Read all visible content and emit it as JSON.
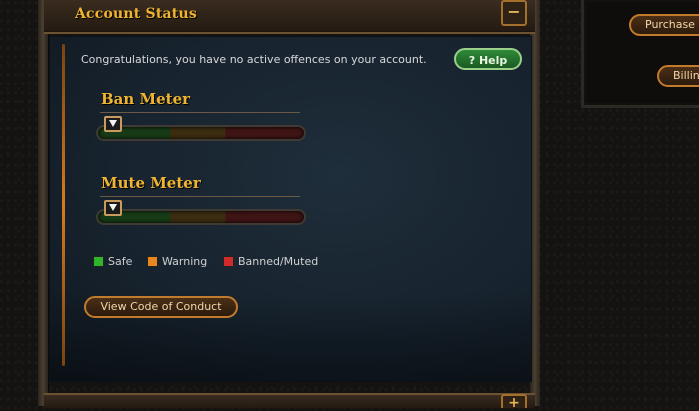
{
  "section": {
    "title": "Account Status",
    "collapse_icon": "−",
    "expand_icon": "+"
  },
  "status": {
    "message": "Congratulations, you have no active offences on your account."
  },
  "help": {
    "icon": "?",
    "label": "Help"
  },
  "meters": [
    {
      "title": "Ban Meter",
      "level": 0.0
    },
    {
      "title": "Mute Meter",
      "level": 0.0
    }
  ],
  "legend": [
    {
      "label": "Safe",
      "color": "#2fb52a"
    },
    {
      "label": "Warning",
      "color": "#e9861f"
    },
    {
      "label": "Banned/Muted",
      "color": "#d12a2a"
    }
  ],
  "actions": {
    "view_code_of_conduct": "View Code of Conduct"
  },
  "side_panel": {
    "purchase_label": "Purchase C",
    "billing_label": "Billin"
  },
  "colors": {
    "accent_gold": "#f0b431",
    "button_border": "#c27a2c",
    "panel_bg": "#17232e",
    "help_green": "#2f8a3a"
  }
}
